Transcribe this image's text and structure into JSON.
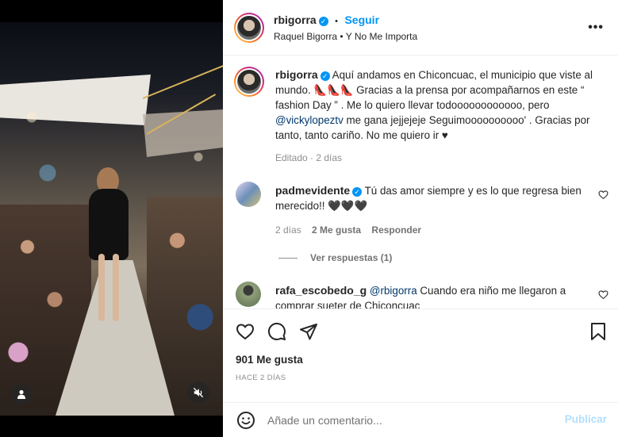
{
  "post": {
    "username": "rbigorra",
    "follow_label": "Seguir",
    "separator": "•",
    "audio": "Raquel Bigorra • Y No Me Importa",
    "more_label": "•••"
  },
  "caption": {
    "username": "rbigorra",
    "text_before": " Aquí andamos en Chiconcuac, el municipio que viste al mundo. 👠👠👠 Gracias a la prensa por acompañarnos en este “ fashion Day ” . Me lo quiero llevar todoooooooooooo, pero ",
    "mention": "@vickylopeztv",
    "text_after": " me gana jejjejeje Seguimoooooooooo' . Gracias por tanto, tanto cariño. No me quiero ir ♥",
    "meta": "Editado · 2 días"
  },
  "comments": [
    {
      "username": "padmevidente",
      "text": " Tú das amor siempre y es lo que regresa bien merecido!! 🖤🖤🖤",
      "time": "2 días",
      "likes": "2 Me gusta",
      "reply": "Responder",
      "view_replies": "Ver respuestas (1)"
    },
    {
      "username": "rafa_escobedo_g",
      "mention": "@rbigorra",
      "text": " Cuando era niño me llegaron a comprar sueter de Chiconcuac"
    }
  ],
  "actions": {
    "likes": "901 Me gusta",
    "date": "HACE 2 DÍAS"
  },
  "composer": {
    "placeholder": "Añade un comentario...",
    "publish": "Publicar"
  },
  "colors": {
    "accent": "#0095f6",
    "publish_disabled": "#b2dffc",
    "text": "#262626",
    "muted": "#8e8e8e"
  }
}
